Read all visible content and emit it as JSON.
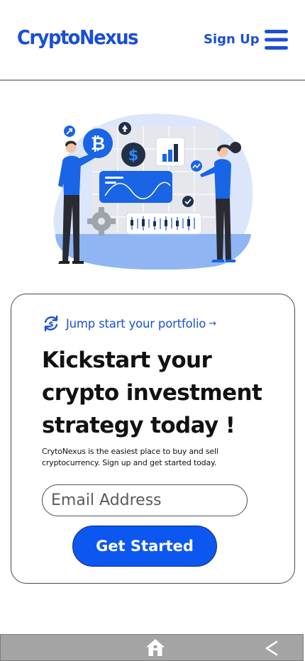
{
  "header": {
    "logo": "CryptoNexus",
    "signup_label": "Sign Up",
    "menu_icon": "hamburger-menu-icon"
  },
  "hero": {
    "illustration": "crypto-investment-illustration"
  },
  "card": {
    "tagline_icon": "refresh-dollar-icon",
    "tagline": "Jump start your portfolio",
    "tagline_arrow": "→",
    "headline_line1": "Kickstart your",
    "headline_line2": "crypto investment",
    "headline_line3": "strategy today !",
    "description_line1": "CrytoNexus is the easiest place to buy and sell",
    "description_line2": "cryptocurrency. Sign up and get started today.",
    "email_placeholder": "Email Address",
    "email_value": "",
    "cta_label": "Get Started"
  },
  "bottom_bar": {
    "home_icon": "home-icon",
    "back_icon": "back-chevron-icon"
  },
  "colors": {
    "brand": "#1a4fd6",
    "cta": "#0b57f0",
    "illustration_blob": "#dbe6fa",
    "bottom_bar": "#a4a4a4"
  }
}
